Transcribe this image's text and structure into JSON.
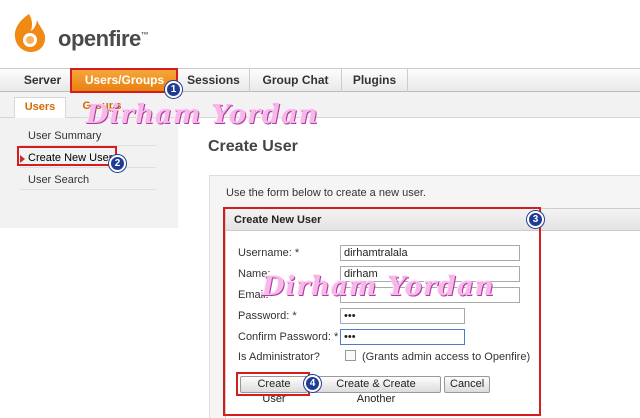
{
  "brand": {
    "name": "openfire",
    "tm": "™"
  },
  "top_nav": {
    "tabs": [
      {
        "label": "Server"
      },
      {
        "label": "Users/Groups",
        "active": true
      },
      {
        "label": "Sessions"
      },
      {
        "label": "Group Chat"
      },
      {
        "label": "Plugins"
      }
    ]
  },
  "sub_nav": {
    "tabs": [
      {
        "label": "Users",
        "active": true
      },
      {
        "label": "Groups"
      }
    ]
  },
  "sidebar": {
    "items": [
      {
        "label": "User Summary"
      },
      {
        "label": "Create New User",
        "active": true
      },
      {
        "label": "User Search"
      }
    ]
  },
  "page": {
    "title": "Create User",
    "intro": "Use the form below to create a new user."
  },
  "form": {
    "header": "Create New User",
    "username": {
      "label": "Username: *",
      "value": "dirhamtralala"
    },
    "name": {
      "label": "Name:",
      "value": "dirham"
    },
    "email": {
      "label": "Email:",
      "value": ""
    },
    "password": {
      "label": "Password: *",
      "value": "•••"
    },
    "confirm_password": {
      "label": "Confirm Password: *",
      "value": "•••"
    },
    "is_admin": {
      "label": "Is Administrator?",
      "hint": "(Grants admin access to Openfire)",
      "checked": false
    },
    "buttons": {
      "create": "Create User",
      "create_another": "Create & Create Another",
      "cancel": "Cancel"
    }
  },
  "annotations": {
    "badges": [
      "1",
      "2",
      "3",
      "4"
    ],
    "highlight_color": "#d41d1d",
    "badge_color": "#1f3c94"
  },
  "watermark": {
    "text": "Dirham Yordan"
  },
  "colors": {
    "accent": "#e87f10",
    "link": "#d26b00"
  }
}
